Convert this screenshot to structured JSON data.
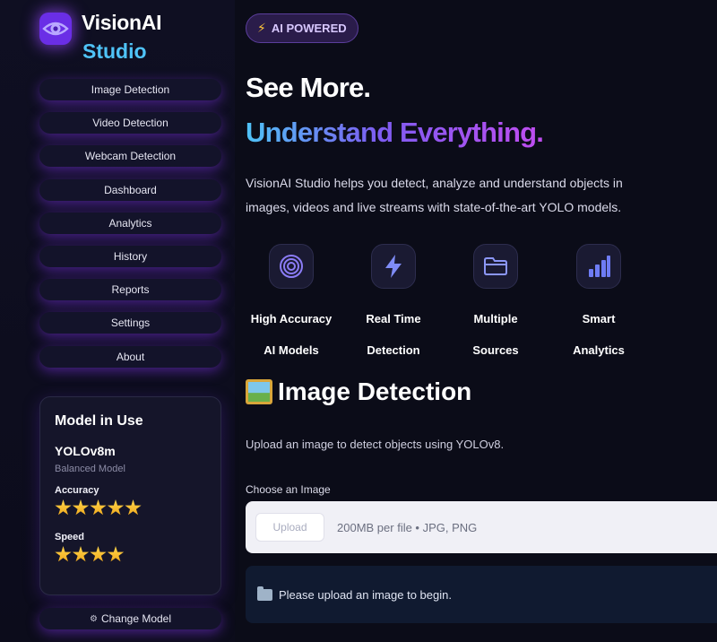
{
  "brand": {
    "name": "VisionAI",
    "sub": "Studio"
  },
  "nav": {
    "items": [
      {
        "label": "Image Detection"
      },
      {
        "label": "Video Detection"
      },
      {
        "label": "Webcam Detection"
      },
      {
        "label": "Dashboard"
      },
      {
        "label": "Analytics"
      },
      {
        "label": "History"
      },
      {
        "label": "Reports"
      },
      {
        "label": "Settings"
      },
      {
        "label": "About"
      }
    ]
  },
  "model_card": {
    "title": "Model in Use",
    "model_name": "YOLOv8m",
    "model_desc": "Balanced Model",
    "accuracy_label": "Accuracy",
    "accuracy_stars": 5,
    "speed_label": "Speed",
    "speed_stars": 4
  },
  "change_model": {
    "label": "Change Model",
    "icon": "gear-icon"
  },
  "badge": {
    "label": "AI POWERED",
    "icon": "lightning-icon"
  },
  "hero": {
    "line1": "See More.",
    "line2": "Understand Everything.",
    "intro": "VisionAI Studio helps you detect, analyze and understand objects in images, videos and live streams with state-of-the-art YOLO models."
  },
  "features": [
    {
      "line1": "High Accuracy",
      "line2": "AI Models",
      "icon": "target-icon"
    },
    {
      "line1": "Real Time",
      "line2": "Detection",
      "icon": "lightning-icon"
    },
    {
      "line1": "Multiple",
      "line2": "Sources",
      "icon": "folder-icon"
    },
    {
      "line1": "Smart",
      "line2": "Analytics",
      "icon": "bar-chart-icon"
    }
  ],
  "section": {
    "title": "Image Detection",
    "icon": "picture-icon",
    "description": "Upload an image to detect objects using YOLOv8."
  },
  "upload": {
    "label": "Choose an Image",
    "button": "Upload",
    "hint": "200MB per file • JPG, PNG"
  },
  "info": {
    "message": "Please upload an image to begin.",
    "icon": "folder-icon"
  },
  "colors": {
    "background": "#0b0c18",
    "accent_purple": "#7d5cf0",
    "accent_blue": "#4fc3f7",
    "star": "#ffc83a"
  }
}
